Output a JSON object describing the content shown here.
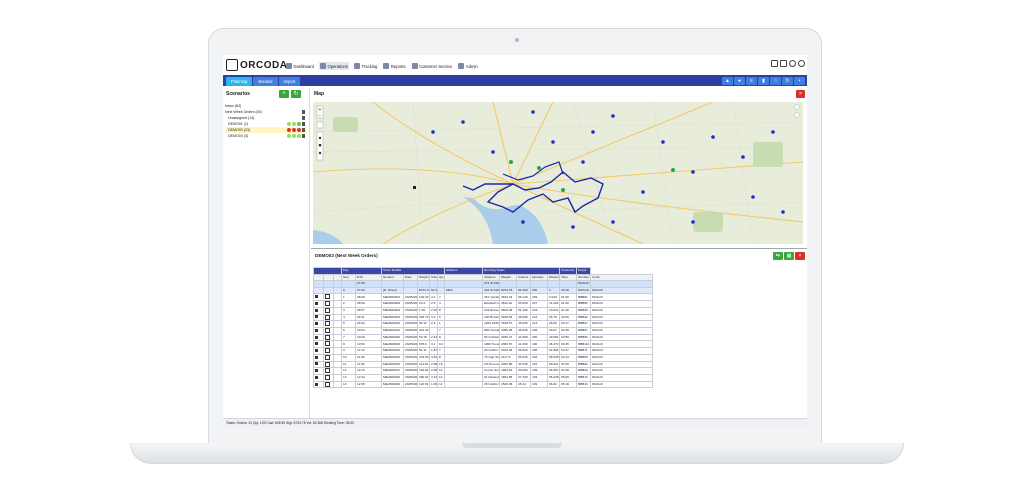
{
  "app": {
    "logo_text": "ORCODA"
  },
  "nav": [
    {
      "label": "Dashboard",
      "icon": "dashboard-icon"
    },
    {
      "label": "Operations",
      "icon": "operations-icon",
      "active": true
    },
    {
      "label": "Tracking",
      "icon": "tracking-icon"
    },
    {
      "label": "Reports",
      "icon": "reports-icon"
    },
    {
      "label": "Customer Service",
      "icon": "headset-icon"
    },
    {
      "label": "Admin",
      "icon": "admin-icon"
    }
  ],
  "tabs": [
    {
      "label": "Planning",
      "active": true
    },
    {
      "label": "Booked"
    },
    {
      "label": "Import"
    }
  ],
  "scenarios": {
    "title": "Scenarios",
    "items": [
      {
        "label": "Inbox (83)",
        "level": 0
      },
      {
        "label": "Next Week Orders (40)",
        "level": 0
      },
      {
        "label": "Unassigned (14)",
        "level": 1
      },
      {
        "label": "DEMO01 (2)",
        "level": 1,
        "dots": [
          "#9bdc5c",
          "#9bdc5c",
          "#6cc04a"
        ]
      },
      {
        "label": "DEMO03 (23)",
        "level": 1,
        "selected": true,
        "dots": [
          "#e0322b",
          "#e0322b",
          "#e0322b"
        ]
      },
      {
        "label": "DEMO04 (3)",
        "level": 1,
        "dots": [
          "#9bdc5c",
          "#9bdc5c",
          "#9bdc5c"
        ]
      }
    ]
  },
  "map": {
    "title": "Map"
  },
  "orders": {
    "title": "DEMO03",
    "subtitle": "(Next Week Orders)",
    "group_headers": [
      "Day",
      "Order Details",
      "Address",
      "Running Totals",
      "Customer",
      "Depot"
    ],
    "columns": [
      "Seq",
      "ETA",
      "Number",
      "Date",
      "Weight",
      "Volume",
      "Qty",
      "",
      "Address",
      "Weight",
      "Volume",
      "Quantity",
      "Distance",
      "Time",
      "Number",
      "Code"
    ],
    "rows": [
      [
        "",
        "07:30",
        "",
        "",
        "",
        "",
        "",
        "",
        "273 St Kilda Road, Mel...",
        "",
        "",
        "",
        "",
        "",
        "DDAUC",
        ""
      ],
      [
        "0",
        "07:30",
        "[D: Driver]",
        "",
        "$734.78",
        "82.368",
        "",
        "DEO",
        "434 St Kilda Road, Mel...",
        "$734.78",
        "82.368",
        "230",
        "0",
        "00:40",
        "DDAUC",
        "DDAUC"
      ],
      [
        "1",
        "08:28",
        "MELB00001",
        "23/05/2022",
        "102.34",
        "4.1",
        "7",
        "",
        "261 Yarraburg road B...",
        "3634.44",
        "56.149",
        "229",
        "9.019",
        "01:00",
        "BBB81",
        "DDAUC"
      ],
      [
        "2",
        "08:46",
        "MELB00002",
        "23/05/2022",
        "23.4",
        "2.5",
        "3",
        "",
        "Elizabeth street, Mel...",
        "3611.04",
        "53.668",
        "227",
        "11.442",
        "01:20",
        "BBB85",
        "DDAUC"
      ],
      [
        "3",
        "08:57",
        "MELB00003",
        "23/05/2022",
        "1.56",
        "2.92",
        "8",
        "",
        "219 Russell street, Me...",
        "3609.48",
        "51.199",
        "219",
        "13.811",
        "01:30",
        "BBB90",
        "DDAUC"
      ],
      [
        "4",
        "09:11",
        "MELB00004",
        "23/05/2022",
        "200.79",
        "3.2",
        "5",
        "",
        "100 Bunter road, Mel...",
        "3408.69",
        "48.069",
        "214",
        "25.79",
        "02:06",
        "BBB92",
        "DDAUC"
      ],
      [
        "5",
        "09:42",
        "MELB00010",
        "23/05/2022",
        "90.12",
        "2.6",
        "1",
        "",
        "1200 1030 Burke road...",
        "3318.57",
        "45.949",
        "213",
        "28.06",
        "02:17",
        "BBB97",
        "DDAUC"
      ],
      [
        "6",
        "10:04",
        "MELB00014",
        "23/05/2022",
        "222.32",
        "",
        "7",
        "",
        "800 Toorak road, Toor...",
        "3096.25",
        "45.949",
        "206",
        "33.87",
        "02:39",
        "BBB97",
        "DDAUC"
      ],
      [
        "7",
        "10:29",
        "MELB00020",
        "23/05/2022",
        "50.78",
        "2.44",
        "8",
        "",
        "53 Cotham Rd, KEW, V...",
        "3035.47",
        "43.399",
        "200",
        "40.681",
        "02:59",
        "BBB96",
        "DDAUC"
      ],
      [
        "8",
        "10:53",
        "MELB00023",
        "23/05/2022",
        "678.9",
        "3.1",
        "10",
        "",
        "1000 Toorak Road, CA...",
        "2360.57",
        "41.399",
        "190",
        "46.372",
        "03:35",
        "BBB114",
        "DDAUC"
      ],
      [
        "9",
        "11:12",
        "MELB00026",
        "23/05/2022",
        "51.11",
        "1.87",
        "7",
        "",
        "25 Collins St, MELBOU...",
        "2349.46",
        "39.829",
        "186",
        "51.891",
        "03:47",
        "BBB71",
        "DDAUC"
      ],
      [
        "10",
        "11:36",
        "MELB00030",
        "23/05/2022",
        "232.93",
        "3.81",
        "8",
        "",
        "75 Gap Street, POINT M...",
        "2117.5",
        "36.029",
        "163",
        "58.935",
        "04:13",
        "BBB85",
        "DDAUC"
      ],
      [
        "11",
        "11:56",
        "MELB00034",
        "23/05/2022",
        "114.64",
        "2.68",
        "15",
        "",
        "2/179 Lewd Street, S...",
        "2002.86",
        "33.349",
        "151",
        "60.021",
        "04:25",
        "BBB92",
        "DDAUC"
      ],
      [
        "12",
        "12:14",
        "MELB00037",
        "23/05/2022",
        "190.84",
        "2.68",
        "12",
        "",
        "Comer Smithton & Ja...",
        "1902.62",
        "30.669",
        "139",
        "66.357",
        "04:48",
        "BBB23",
        "DDAUC"
      ],
      [
        "13",
        "12:34",
        "MELB00040",
        "23/05/2022",
        "200.94",
        "3.22",
        "14",
        "",
        "61 Flinders Lane, MEL...",
        "1651.68",
        "27.449",
        "129",
        "55.238",
        "05:00",
        "BBB72",
        "DDAUC"
      ],
      [
        "14",
        "12:35",
        "MELB00039",
        "23/05/2022",
        "122.51",
        "1.099",
        "11",
        "",
        "25 Collins Street, MEL...",
        "1528.35",
        "25.44",
        "109",
        "66.82",
        "05:19",
        "BBB16",
        "DDAUC"
      ]
    ]
  },
  "footer": {
    "text": "Totals: Orders: 23 Qty: 109 Cost: 605.59 Wgt: 8734.78 Vol: 82.368 Working Time: 08:30"
  },
  "colors": {
    "accent_blue": "#2e3fa0",
    "tab_blue": "#3d7ee0",
    "green": "#3aa53a",
    "red": "#d9302c",
    "route_blue": "#1728a8"
  }
}
